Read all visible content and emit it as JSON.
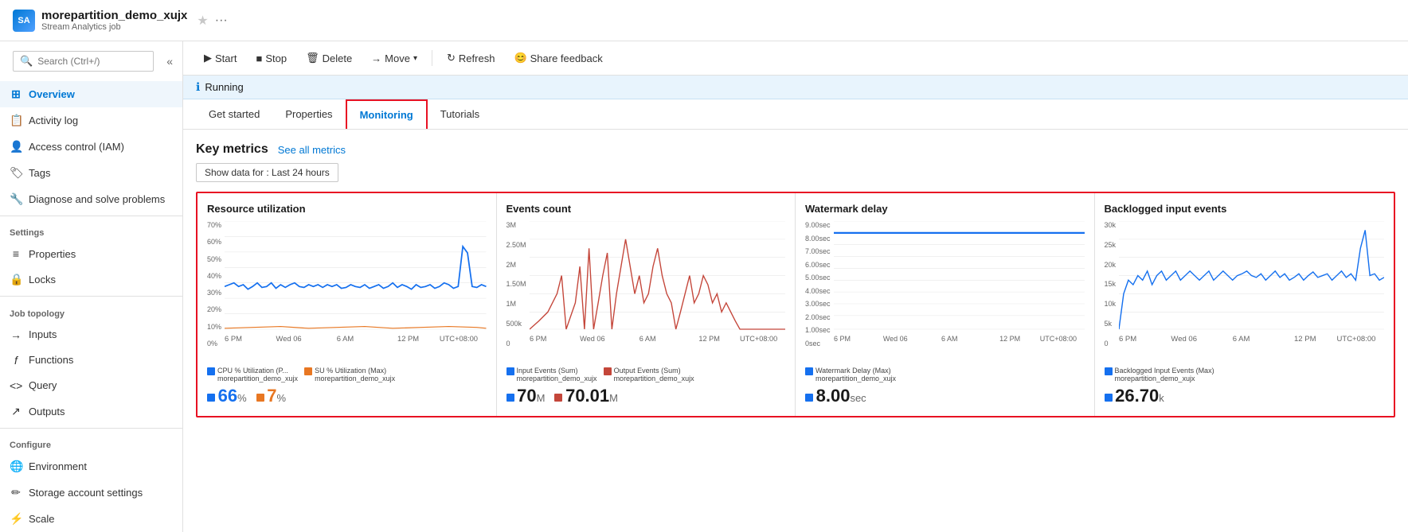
{
  "header": {
    "title": "morepartition_demo_xujx",
    "subtitle": "Stream Analytics job",
    "star_label": "★",
    "more_label": "···"
  },
  "sidebar": {
    "search_placeholder": "Search (Ctrl+/)",
    "collapse_icon": "«",
    "items": [
      {
        "id": "overview",
        "label": "Overview",
        "icon": "⊞",
        "active": true
      },
      {
        "id": "activity-log",
        "label": "Activity log",
        "icon": "📋"
      },
      {
        "id": "access-control",
        "label": "Access control (IAM)",
        "icon": "👤"
      },
      {
        "id": "tags",
        "label": "Tags",
        "icon": "🏷"
      },
      {
        "id": "diagnose",
        "label": "Diagnose and solve problems",
        "icon": "🔧"
      }
    ],
    "sections": [
      {
        "label": "Settings",
        "items": [
          {
            "id": "properties",
            "label": "Properties",
            "icon": "≡"
          },
          {
            "id": "locks",
            "label": "Locks",
            "icon": "🔒"
          }
        ]
      },
      {
        "label": "Job topology",
        "items": [
          {
            "id": "inputs",
            "label": "Inputs",
            "icon": "→"
          },
          {
            "id": "functions",
            "label": "Functions",
            "icon": "ƒ"
          },
          {
            "id": "query",
            "label": "Query",
            "icon": "<>"
          },
          {
            "id": "outputs",
            "label": "Outputs",
            "icon": "↗"
          }
        ]
      },
      {
        "label": "Configure",
        "items": [
          {
            "id": "environment",
            "label": "Environment",
            "icon": "🌐"
          },
          {
            "id": "storage-account",
            "label": "Storage account settings",
            "icon": "✏"
          },
          {
            "id": "scale",
            "label": "Scale",
            "icon": "⚡"
          }
        ]
      }
    ]
  },
  "toolbar": {
    "buttons": [
      {
        "id": "start",
        "label": "Start",
        "icon": "▶"
      },
      {
        "id": "stop",
        "label": "Stop",
        "icon": "■"
      },
      {
        "id": "delete",
        "label": "Delete",
        "icon": "🗑"
      },
      {
        "id": "move",
        "label": "Move",
        "icon": "→"
      },
      {
        "id": "refresh",
        "label": "Refresh",
        "icon": "↻"
      },
      {
        "id": "share",
        "label": "Share feedback",
        "icon": "😊"
      }
    ]
  },
  "status": {
    "icon": "ℹ",
    "text": "Running"
  },
  "tabs": [
    {
      "id": "get-started",
      "label": "Get started"
    },
    {
      "id": "properties",
      "label": "Properties"
    },
    {
      "id": "monitoring",
      "label": "Monitoring",
      "active": true
    },
    {
      "id": "tutorials",
      "label": "Tutorials"
    }
  ],
  "monitoring": {
    "title": "Key metrics",
    "see_all_label": "See all metrics",
    "filter_label": "Show data for : Last 24 hours",
    "charts": [
      {
        "id": "resource-utilization",
        "title": "Resource utilization",
        "y_labels": [
          "70%",
          "60%",
          "50%",
          "40%",
          "30%",
          "20%",
          "10%",
          "0%"
        ],
        "x_labels": [
          "6 PM",
          "Wed 06",
          "6 AM",
          "12 PM",
          "UTC+08:00"
        ],
        "legend": [
          {
            "label": "CPU % Utilization (P...\nmorepartition_demo_xujx",
            "color": "#1570EF"
          },
          {
            "label": "SU % Utilization (Max)\nmorepartition_demo_xujx",
            "color": "#E87722"
          }
        ],
        "values": [
          {
            "label": "66",
            "unit": "%",
            "color": "#1570EF"
          },
          {
            "label": "7",
            "unit": "%",
            "color": "#E87722"
          }
        ],
        "line_color": "#1570EF",
        "line2_color": "#E87722"
      },
      {
        "id": "events-count",
        "title": "Events count",
        "y_labels": [
          "3M",
          "2.50M",
          "2M",
          "1.50M",
          "1M",
          "500k",
          "0"
        ],
        "x_labels": [
          "6 PM",
          "Wed 06",
          "6 AM",
          "12 PM",
          "UTC+08:00"
        ],
        "legend": [
          {
            "label": "Input Events (Sum)\nmorepartition_demo_xujx",
            "color": "#1570EF"
          },
          {
            "label": "Output Events (Sum)\nmorepartition_demo_xujx",
            "color": "#C4463A"
          }
        ],
        "values": [
          {
            "label": "70",
            "unit": "M",
            "color": "#1570EF"
          },
          {
            "label": "70.01",
            "unit": "M",
            "color": "#C4463A"
          }
        ],
        "line_color": "#C4463A"
      },
      {
        "id": "watermark-delay",
        "title": "Watermark delay",
        "y_labels": [
          "9.00sec",
          "8.00sec",
          "7.00sec",
          "6.00sec",
          "5.00sec",
          "4.00sec",
          "3.00sec",
          "2.00sec",
          "1.00sec",
          "0sec"
        ],
        "x_labels": [
          "6 PM",
          "Wed 06",
          "6 AM",
          "12 PM",
          "UTC+08:00"
        ],
        "legend": [
          {
            "label": "Watermark Delay (Max)\nmorepartition_demo_xujx",
            "color": "#1570EF"
          }
        ],
        "values": [
          {
            "label": "8.00",
            "unit": "sec",
            "color": "#1570EF"
          }
        ],
        "line_color": "#1570EF"
      },
      {
        "id": "backlogged-input",
        "title": "Backlogged input events",
        "y_labels": [
          "30k",
          "25k",
          "20k",
          "15k",
          "10k",
          "5k",
          "0"
        ],
        "x_labels": [
          "6 PM",
          "Wed 06",
          "6 AM",
          "12 PM",
          "UTC+08:00"
        ],
        "legend": [
          {
            "label": "Backlogged Input Events (Max)\nmorepartition_demo_xujx",
            "color": "#1570EF"
          }
        ],
        "values": [
          {
            "label": "26.70",
            "unit": "k",
            "color": "#1570EF"
          }
        ],
        "line_color": "#1570EF"
      }
    ]
  }
}
